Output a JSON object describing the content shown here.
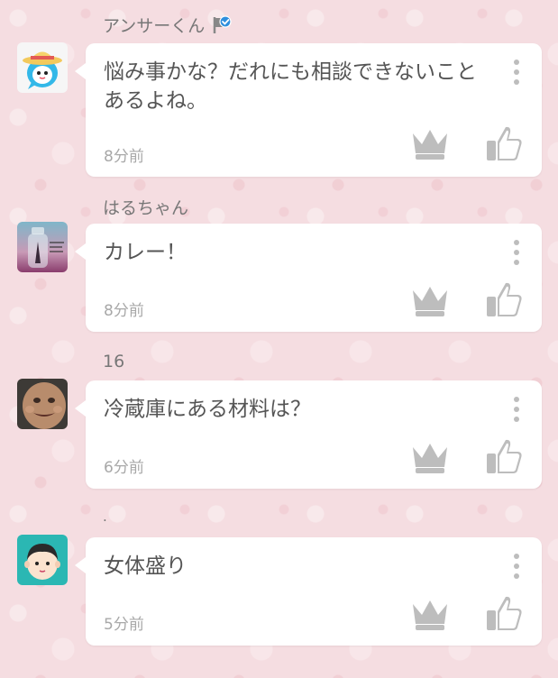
{
  "posts": [
    {
      "author": "アンサーくん",
      "verified": true,
      "message": "悩み事かな？だれにも相談できないことあるよね。",
      "time": "8分前",
      "avatar_icon": "bear-hat-avatar-icon"
    },
    {
      "author": "はるちゃん",
      "verified": false,
      "message": "カレー！",
      "time": "8分前",
      "avatar_icon": "bottle-avatar-icon"
    },
    {
      "author": "16",
      "verified": false,
      "message": "冷蔵庫にある材料は？",
      "time": "6分前",
      "avatar_icon": "face-avatar-icon"
    },
    {
      "author": ".",
      "verified": false,
      "message": "女体盛り",
      "time": "5分前",
      "avatar_icon": "boy-avatar-icon"
    }
  ],
  "colors": {
    "background": "#f5dde1",
    "card": "#ffffff",
    "icon_gray": "#bdbdbd",
    "text": "#555555",
    "muted": "#a8a8a8",
    "verified_blue": "#2f8fdd"
  }
}
